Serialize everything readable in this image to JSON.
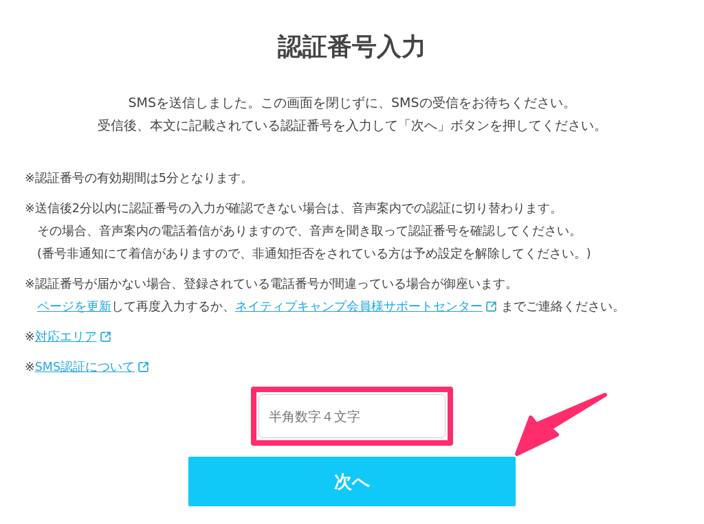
{
  "title": "認証番号入力",
  "intro": [
    "SMSを送信しました。この画面を閉じずに、SMSの受信をお待ちください。",
    "受信後、本文に記載されている認証番号を入力して「次へ」ボタンを押してください。"
  ],
  "notes": [
    {
      "lines": [
        [
          {
            "kind": "text",
            "text": "※認証番号の有効期間は5分となります。"
          }
        ]
      ]
    },
    {
      "lines": [
        [
          {
            "kind": "text",
            "text": "※送信後2分以内に認証番号の入力が確認できない場合は、音声案内での認証に切り替わります。"
          }
        ],
        [
          {
            "kind": "text",
            "text": "その場合、音声案内の電話着信がありますので、音声を聞き取って認証番号を確認してください。"
          }
        ],
        [
          {
            "kind": "text",
            "text": "(番号非通知にて着信がありますので、非通知拒否をされている方は予め設定を解除してください。)"
          }
        ]
      ]
    },
    {
      "lines": [
        [
          {
            "kind": "text",
            "text": "※認証番号が届かない場合、登録されている電話番号が間違っている場合が御座います。"
          }
        ],
        [
          {
            "kind": "link",
            "text": "ページを更新",
            "external": false
          },
          {
            "kind": "text",
            "text": "して再度入力するか、"
          },
          {
            "kind": "link",
            "text": "ネイティブキャンプ会員様サポートセンター",
            "external": true
          },
          {
            "kind": "text",
            "text": " までご連絡ください。"
          }
        ]
      ]
    },
    {
      "lines": [
        [
          {
            "kind": "text",
            "text": "※"
          },
          {
            "kind": "link",
            "text": "対応エリア",
            "external": true
          }
        ]
      ]
    },
    {
      "lines": [
        [
          {
            "kind": "text",
            "text": "※"
          },
          {
            "kind": "link",
            "text": "SMS認証について",
            "external": true
          }
        ]
      ]
    }
  ],
  "code_field": {
    "placeholder": "半角数字４文字",
    "highlighted": true
  },
  "next_button": "次へ"
}
